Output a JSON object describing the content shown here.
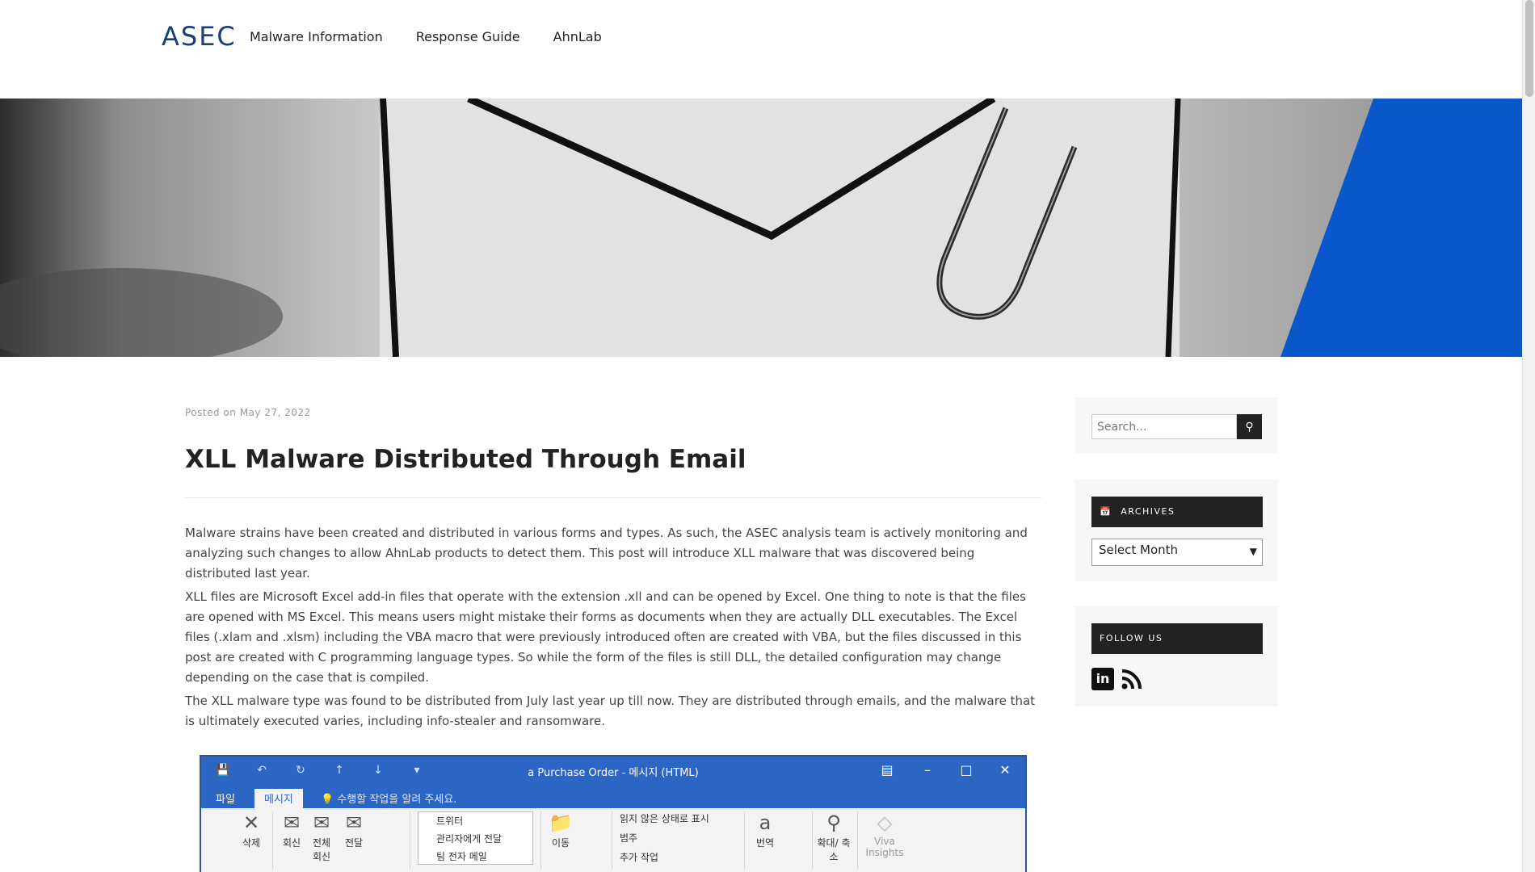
{
  "header": {
    "logo_text": "ASEC",
    "nav": [
      {
        "label": "Malware Information"
      },
      {
        "label": "Response Guide"
      },
      {
        "label": "AhnLab"
      }
    ]
  },
  "post": {
    "posted_prefix": "Posted on",
    "date": "May 27, 2022",
    "title": "XLL Malware Distributed Through Email",
    "paragraphs": [
      "Malware strains have been created and distributed in various forms and types. As such, the ASEC analysis team is actively monitoring and analyzing such changes to allow AhnLab products to detect them. This post will introduce XLL malware that was discovered being distributed last year.",
      "XLL files are Microsoft Excel add-in files that operate with the extension .xll and can be opened by Excel. One thing to note is that the files are opened with MS Excel. This means users might mistake their forms as documents when they are actually DLL executables. The Excel files (.xlam and .xlsm) including the VBA macro that were previously introduced often are created with VBA, but the files discussed in this post are created with C programming language types. So while the form of the files is still DLL, the detailed configuration may change depending on the case that is compiled.",
      "The XLL malware type was found to be distributed from July last year up till now. They are distributed through emails, and the malware that is ultimately executed varies, including info-stealer and ransomware."
    ]
  },
  "screenshot": {
    "window_title": "a Purchase Order - 메시지 (HTML)",
    "tabs": [
      "파일",
      "메시지"
    ],
    "hint": "수행할 작업을 알려 주세요.",
    "ribbon": {
      "delete": "삭제",
      "reply": "회신",
      "reply_all": "전체 회신",
      "forward": "전달",
      "quick_steps": [
        "트위터",
        "관리자에게 전달",
        "팀 전자 메일"
      ],
      "move": "이동",
      "unread": "읽지 않은 상태로 표시",
      "category": "범주",
      "followup": "추가 작업",
      "translate": "번역",
      "zoom": "확대/ 축소",
      "viva": "Viva Insights"
    }
  },
  "sidebar": {
    "search_placeholder": "Search...",
    "archives_title": "ARCHIVES",
    "archives_select": "Select Month",
    "follow_title": "FOLLOW US",
    "social": [
      "linkedin-icon",
      "rss-icon"
    ]
  }
}
